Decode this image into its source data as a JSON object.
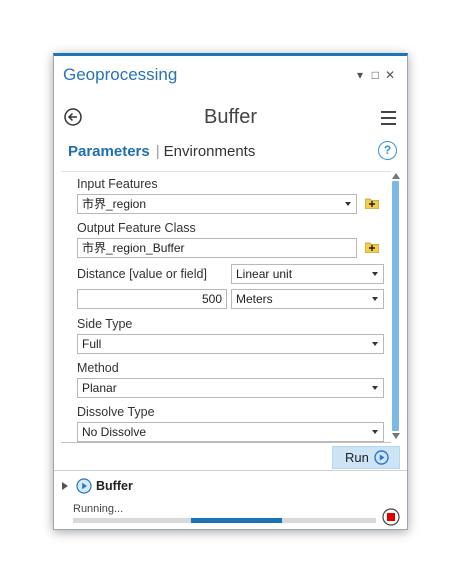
{
  "pane": {
    "title": "Geoprocessing",
    "controls": {
      "pin": "▾",
      "maximize": "□",
      "close": "✕"
    }
  },
  "header": {
    "tool_title": "Buffer"
  },
  "tabs": {
    "parameters": "Parameters",
    "separator": "|",
    "environments": "Environments"
  },
  "help": {
    "glyph": "?"
  },
  "params": {
    "input_features": {
      "label": "Input Features",
      "value": "市界_region"
    },
    "output_feature_class": {
      "label": "Output Feature Class",
      "value": "市界_region_Buffer"
    },
    "distance": {
      "label": "Distance [value or field]",
      "mode": "Linear unit",
      "value": "500",
      "unit": "Meters"
    },
    "side_type": {
      "label": "Side Type",
      "value": "Full"
    },
    "method": {
      "label": "Method",
      "value": "Planar"
    },
    "dissolve_type": {
      "label": "Dissolve Type",
      "value": "No Dissolve"
    }
  },
  "run_button": {
    "label": "Run"
  },
  "job": {
    "name": "Buffer",
    "status": "Running...",
    "progress_start": 0.39,
    "progress_end": 0.69
  },
  "colors": {
    "accent": "#1976b8",
    "run_bg": "#cde4f7",
    "stop": "#e00000",
    "scroll_thumb": "#7cb9e8"
  }
}
